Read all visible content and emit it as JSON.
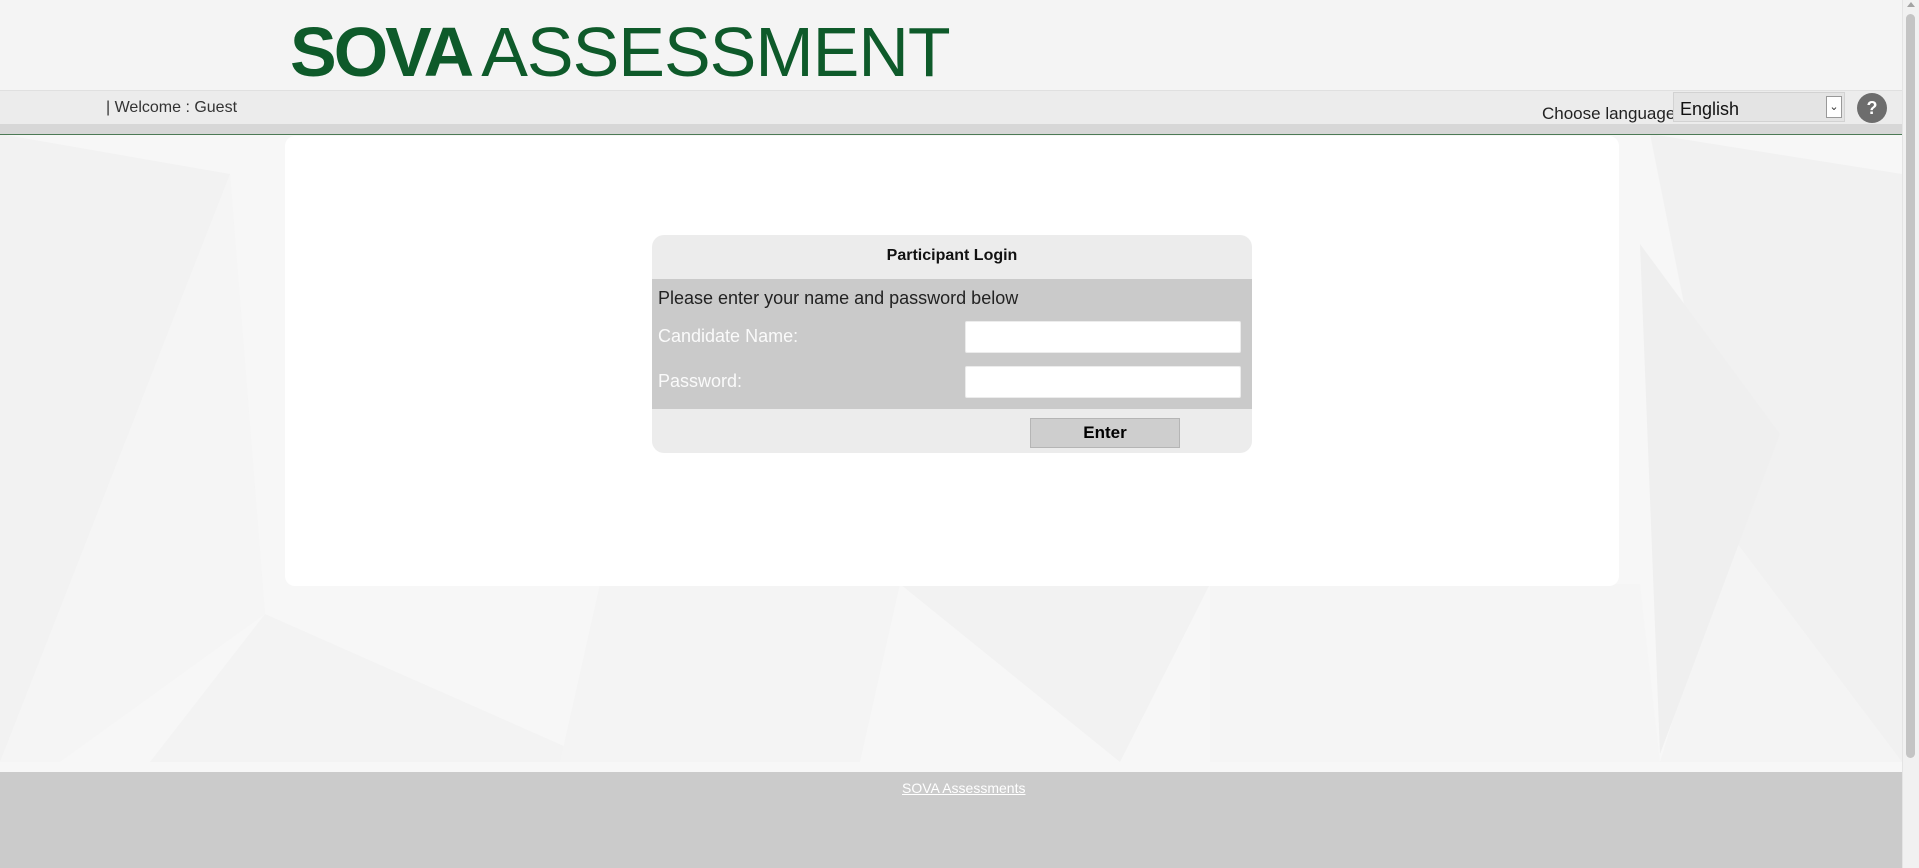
{
  "header": {
    "logo_bold": "SOVA",
    "logo_light": "ASSESSMENT"
  },
  "welcome_bar": {
    "welcome_text": "| Welcome : Guest",
    "language_label": "Choose language",
    "language_selected": "English",
    "help_symbol": "?"
  },
  "login": {
    "title": "Participant Login",
    "instructions": "Please enter your name and password below",
    "name_label": "Candidate Name:",
    "name_value": "",
    "password_label": "Password:",
    "password_value": "",
    "enter_label": "Enter"
  },
  "footer": {
    "link_text": "SOVA Assessments"
  },
  "icons": {
    "dropdown": "chevron-down-icon",
    "help": "help-icon",
    "scroll_up": "arrow-up-icon"
  },
  "colors": {
    "brand_green": "#0e5a2a",
    "footer_gray": "#cbcbcb",
    "login_body_gray": "#cacaca"
  }
}
